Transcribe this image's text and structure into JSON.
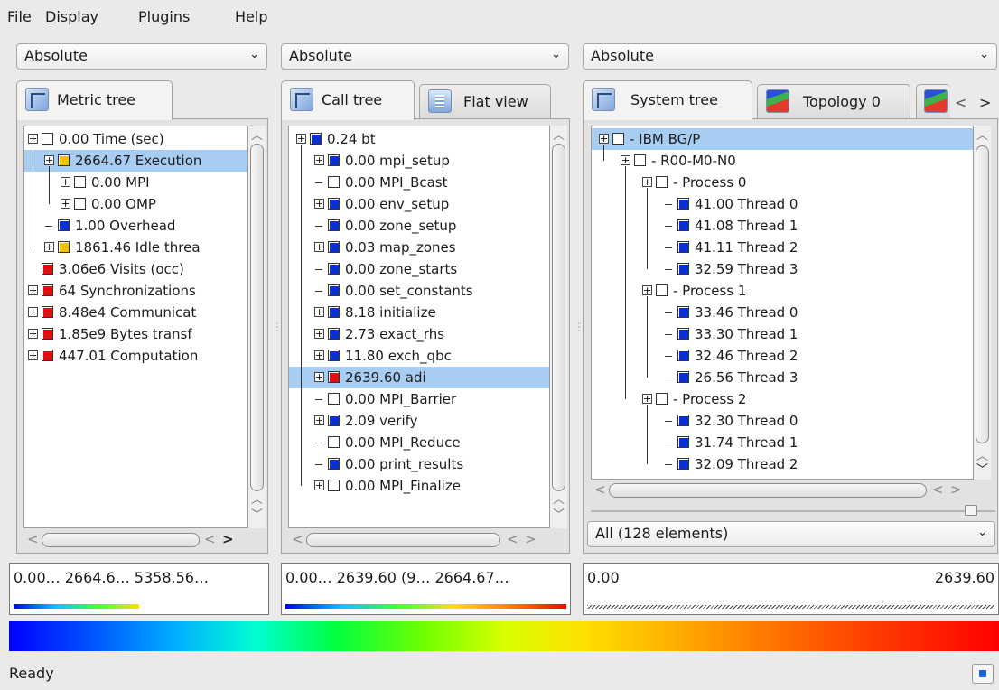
{
  "menu": {
    "items": [
      {
        "pre": "",
        "ul": "F",
        "post": "ile"
      },
      {
        "pre": "",
        "ul": "D",
        "post": "isplay"
      },
      {
        "pre": "",
        "ul": "P",
        "post": "lugins"
      },
      {
        "pre": "",
        "ul": "H",
        "post": "elp"
      }
    ]
  },
  "combos": {
    "metric": "Absolute",
    "call": "Absolute",
    "system": "Absolute",
    "arrow": "⌄"
  },
  "tabs": {
    "metric": [
      {
        "label": "Metric tree",
        "icon": "tree-icon"
      }
    ],
    "call": [
      {
        "label": "Call tree",
        "icon": "tree-icon"
      },
      {
        "label": "Flat view",
        "icon": "flat-view-icon"
      }
    ],
    "system": [
      {
        "label": "System tree",
        "icon": "tree-icon"
      },
      {
        "label": "Topology 0",
        "icon": "topology-icon"
      }
    ],
    "nav_prev": "<",
    "nav_next": ">"
  },
  "metric_tree": [
    {
      "text": "0.00 Time (sec)",
      "level": 0,
      "exp": true,
      "color": ""
    },
    {
      "text": "2664.67 Execution",
      "level": 1,
      "exp": true,
      "color": "#f2c200",
      "selected": true
    },
    {
      "text": "0.00 MPI",
      "level": 2,
      "exp": true,
      "color": ""
    },
    {
      "text": "0.00 OMP",
      "level": 2,
      "exp": true,
      "color": ""
    },
    {
      "text": "1.00 Overhead",
      "level": 1,
      "exp": false,
      "color": "#0a2fd9"
    },
    {
      "text": "1861.46 Idle threa",
      "level": 1,
      "exp": true,
      "color": "#f2c200"
    },
    {
      "text": "3.06e6 Visits (occ)",
      "level": 0,
      "exp": false,
      "color": "#e01010"
    },
    {
      "text": "64 Synchronizations",
      "level": 0,
      "exp": true,
      "color": "#e01010"
    },
    {
      "text": "8.48e4 Communicat",
      "level": 0,
      "exp": true,
      "color": "#e01010"
    },
    {
      "text": "1.85e9 Bytes transf",
      "level": 0,
      "exp": true,
      "color": "#e01010"
    },
    {
      "text": "447.01 Computation",
      "level": 0,
      "exp": true,
      "color": "#e01010"
    }
  ],
  "call_tree": [
    {
      "text": "0.24 bt",
      "level": 0,
      "exp": true,
      "color": "#0a2fd9"
    },
    {
      "text": "0.00 mpi_setup",
      "level": 1,
      "exp": true,
      "color": "#0a2fd9"
    },
    {
      "text": "0.00 MPI_Bcast",
      "level": 1,
      "exp": false,
      "color": ""
    },
    {
      "text": "0.00 env_setup",
      "level": 1,
      "exp": true,
      "color": "#0a2fd9"
    },
    {
      "text": "0.00 zone_setup",
      "level": 1,
      "exp": false,
      "color": "#0a2fd9"
    },
    {
      "text": "0.03 map_zones",
      "level": 1,
      "exp": true,
      "color": "#0a2fd9"
    },
    {
      "text": "0.00 zone_starts",
      "level": 1,
      "exp": false,
      "color": "#0a2fd9"
    },
    {
      "text": "0.00 set_constants",
      "level": 1,
      "exp": false,
      "color": "#0a2fd9"
    },
    {
      "text": "8.18 initialize",
      "level": 1,
      "exp": true,
      "color": "#0a2fd9"
    },
    {
      "text": "2.73 exact_rhs",
      "level": 1,
      "exp": true,
      "color": "#0a2fd9"
    },
    {
      "text": "11.80 exch_qbc",
      "level": 1,
      "exp": true,
      "color": "#0a2fd9"
    },
    {
      "text": "2639.60 adi",
      "level": 1,
      "exp": true,
      "color": "#e01010",
      "selected": true
    },
    {
      "text": "0.00 MPI_Barrier",
      "level": 1,
      "exp": false,
      "color": ""
    },
    {
      "text": "2.09 verify",
      "level": 1,
      "exp": true,
      "color": "#0a2fd9"
    },
    {
      "text": "0.00 MPI_Reduce",
      "level": 1,
      "exp": false,
      "color": ""
    },
    {
      "text": "0.00 print_results",
      "level": 1,
      "exp": false,
      "color": "#0a2fd9"
    },
    {
      "text": "0.00 MPI_Finalize",
      "level": 1,
      "exp": true,
      "color": ""
    }
  ],
  "system_tree": [
    {
      "text": "- IBM BG/P",
      "level": 0,
      "exp": true,
      "color": "",
      "selected": true
    },
    {
      "text": "- R00-M0-N0",
      "level": 1,
      "exp": true,
      "color": ""
    },
    {
      "text": "- Process 0",
      "level": 2,
      "exp": true,
      "color": ""
    },
    {
      "text": "41.00 Thread 0",
      "level": 3,
      "exp": false,
      "color": "#0a2fd9"
    },
    {
      "text": "41.08 Thread 1",
      "level": 3,
      "exp": false,
      "color": "#0a2fd9"
    },
    {
      "text": "41.11 Thread 2",
      "level": 3,
      "exp": false,
      "color": "#0a2fd9"
    },
    {
      "text": "32.59 Thread 3",
      "level": 3,
      "exp": false,
      "color": "#0a2fd9"
    },
    {
      "text": "- Process 1",
      "level": 2,
      "exp": true,
      "color": ""
    },
    {
      "text": "33.46 Thread 0",
      "level": 3,
      "exp": false,
      "color": "#0a2fd9"
    },
    {
      "text": "33.30 Thread 1",
      "level": 3,
      "exp": false,
      "color": "#0a2fd9"
    },
    {
      "text": "32.46 Thread 2",
      "level": 3,
      "exp": false,
      "color": "#0a2fd9"
    },
    {
      "text": "26.56 Thread 3",
      "level": 3,
      "exp": false,
      "color": "#0a2fd9"
    },
    {
      "text": "- Process 2",
      "level": 2,
      "exp": true,
      "color": ""
    },
    {
      "text": "32.30 Thread 0",
      "level": 3,
      "exp": false,
      "color": "#0a2fd9"
    },
    {
      "text": "31.74 Thread 1",
      "level": 3,
      "exp": false,
      "color": "#0a2fd9"
    },
    {
      "text": "32.09 Thread 2",
      "level": 3,
      "exp": false,
      "color": "#0a2fd9"
    }
  ],
  "system_filter": "All (128 elements)",
  "value_boxes": {
    "metric": "0.00… 2664.6… 5358.56…",
    "call": "0.00… 2639.60 (9… 2664.67…",
    "system_min": "0.00",
    "system_max": "2639.60",
    "metric_fill": 0.5,
    "call_fill": 1.0
  },
  "status": {
    "text": "Ready"
  },
  "colors": {
    "selection": "#a8cdf3",
    "blue": "#0a2fd9",
    "red": "#e01010",
    "yellow": "#f2c200"
  }
}
